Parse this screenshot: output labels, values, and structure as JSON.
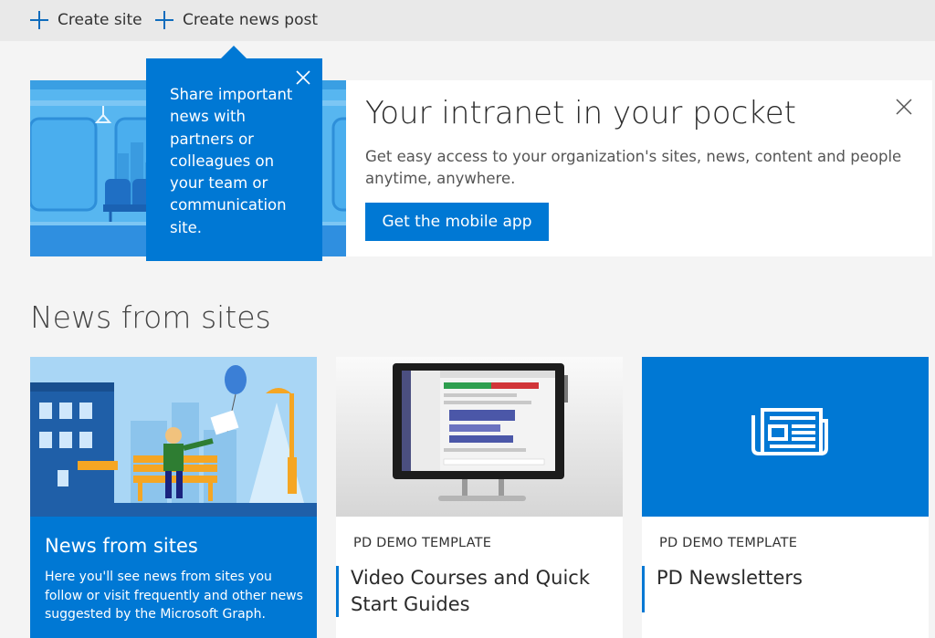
{
  "commandbar": {
    "create_site": "Create site",
    "create_news_post": "Create news post"
  },
  "teaching_bubble": {
    "text": "Share important news with partners or colleagues on your team or communication site."
  },
  "banner": {
    "title": "Your intranet in your pocket",
    "description": "Get easy access to your organization's sites, news, content and people anytime, anywhere.",
    "button_label": "Get the mobile app"
  },
  "news_section": {
    "title": "News from sites"
  },
  "cards": [
    {
      "title": "News from sites",
      "description": "Here you'll see news from sites you follow or visit frequently and other news suggested by the Microsoft Graph."
    },
    {
      "site": "PD DEMO TEMPLATE",
      "headline": "Video Courses and Quick Start Guides"
    },
    {
      "site": "PD DEMO TEMPLATE",
      "headline": "PD Newsletters"
    }
  ],
  "colors": {
    "accent": "#0078d4",
    "banner_sky": "#57b6f0",
    "commandbar_bg": "#e9e9e9",
    "page_bg": "#f4f4f4"
  },
  "icons": [
    "plus-icon",
    "close-icon",
    "newspaper-icon"
  ]
}
